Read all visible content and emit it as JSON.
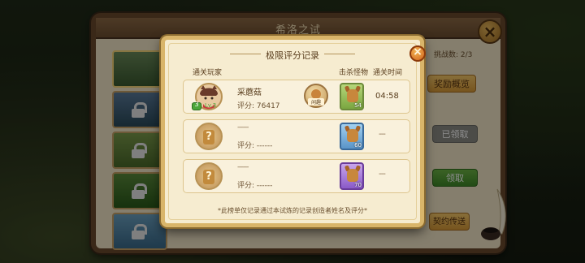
{
  "back_window": {
    "title": "希洛之试",
    "challenge_count": "挑战数: 2/3",
    "reward_btn": "奖励概览",
    "claimed_btn": "已领取",
    "claim_btn": "领取",
    "contract_btn": "契约传送"
  },
  "modal": {
    "title": "极限评分记录",
    "close_icon": "×",
    "columns": {
      "player": "通关玩家",
      "monsters": "击杀怪物",
      "time": "通关时间"
    },
    "rows": [
      {
        "name": "采蘑菇",
        "score": "评分: 76417",
        "level": "3",
        "level_label": "Lv.3",
        "guild_label": "闲趣",
        "monster_count": "54",
        "time": "04:58"
      },
      {
        "name": "------",
        "score": "评分: ------",
        "monster_count": "60",
        "time": "---"
      },
      {
        "name": "------",
        "score": "评分: ------",
        "monster_count": "70",
        "time": "---"
      }
    ],
    "footnote": "*此榜单仅记录通过本试炼的记录创造者姓名及评分*"
  },
  "question_mark": "?",
  "colors": {
    "accent_orange": "#d0621c",
    "panel": "#f6ecd0",
    "border_gold": "#d9b56a"
  }
}
